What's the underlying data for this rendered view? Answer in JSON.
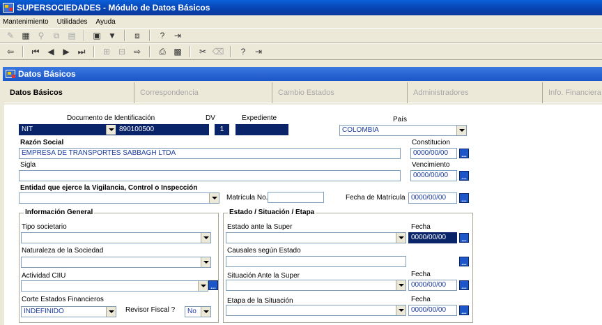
{
  "window": {
    "title": "SUPERSOCIEDADES - Módulo de Datos Básicos"
  },
  "menu": [
    "Mantenimiento",
    "Utilidades",
    "Ayuda"
  ],
  "inner_window": {
    "title": "Datos Básicos"
  },
  "tabs": [
    {
      "label": "Datos Básicos"
    },
    {
      "label": "Correspondencia"
    },
    {
      "label": "Cambio Estados"
    },
    {
      "label": "Administradores"
    },
    {
      "label": "Info. Financiera"
    }
  ],
  "form": {
    "doc_id_label": "Documento de Identificación",
    "doc_type": "NIT",
    "doc_number": "890100500",
    "dv_label": "DV",
    "dv": "1",
    "expediente_label": "Expediente",
    "expediente": "",
    "pais_label": "País",
    "pais": "COLOMBIA",
    "razon_social_label": "Razón Social",
    "razon_social": "EMPRESA DE TRANSPORTES SABBAGH LTDA",
    "constitucion_label": "Constitucion",
    "constitucion": "0000/00/00",
    "sigla_label": "Sigla",
    "sigla": "",
    "vencimiento_label": "Vencimiento",
    "vencimiento": "0000/00/00",
    "entidad_label": "Entidad que ejerce la Vigilancia, Control o Inspección",
    "entidad": "",
    "matricula_label": "Matrícula No.",
    "matricula": "",
    "fecha_matricula_label": "Fecha de Matrícula",
    "fecha_matricula": "0000/00/00"
  },
  "info_general": {
    "title": "Información General",
    "tipo_societario_label": "Tipo societario",
    "tipo_societario": "",
    "naturaleza_label": "Naturaleza de la Sociedad",
    "naturaleza": "",
    "actividad_label": "Actividad CIIU",
    "actividad": "",
    "corte_label": "Corte Estados Financieros",
    "corte": "INDEFINIDO",
    "revisor_label": "Revisor Fiscal ?",
    "revisor": "No"
  },
  "estado": {
    "title": "Estado / Situación / Etapa",
    "estado_super_label": "Estado ante la Super",
    "estado_super": "",
    "fecha_label": "Fecha",
    "fecha1": "0000/00/00",
    "causales_label": "Causales según Estado",
    "causales": "",
    "situacion_label": "Situación Ante la Super",
    "situacion": "",
    "fecha2": "0000/00/00",
    "etapa_label": "Etapa de la Situación",
    "etapa": "",
    "fecha3": "0000/00/00"
  },
  "calendar_button_label": "...",
  "colors": {
    "title_bar": "#0842b0",
    "inner_title": "#1c56c8",
    "selected_field": "#0a246a",
    "field_text": "#1a3aa0"
  }
}
